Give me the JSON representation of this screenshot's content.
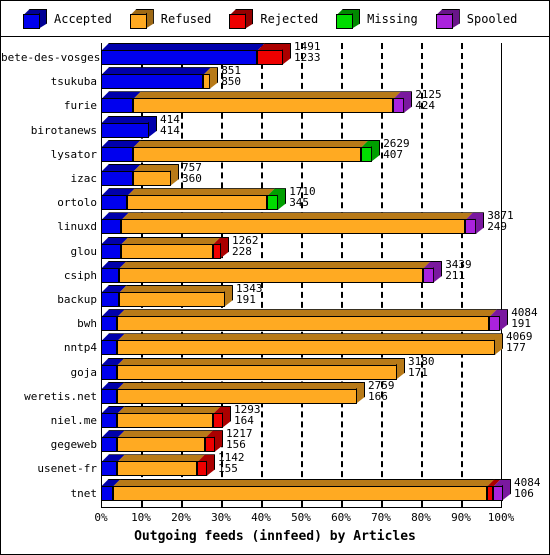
{
  "legend": {
    "items": [
      {
        "label": "Accepted",
        "color": "#0000ee",
        "icon": "cube-icon"
      },
      {
        "label": "Refused",
        "color": "#ffaa22",
        "icon": "cube-icon"
      },
      {
        "label": "Rejected",
        "color": "#ee0000",
        "icon": "cube-icon"
      },
      {
        "label": "Missing",
        "color": "#00dd00",
        "icon": "cube-icon"
      },
      {
        "label": "Spooled",
        "color": "#aa22dd",
        "icon": "cube-icon"
      }
    ]
  },
  "chart_data": {
    "type": "bar",
    "orientation": "horizontal",
    "stacked": true,
    "percent_stacked": true,
    "title": "Outgoing feeds (innfeed) by Articles",
    "xlabel": "Outgoing feeds (innfeed) by Articles",
    "ylabel": "",
    "xlim": [
      0,
      100
    ],
    "xticks": [
      "0%",
      "10%",
      "20%",
      "30%",
      "40%",
      "50%",
      "60%",
      "70%",
      "80%",
      "90%",
      "100%"
    ],
    "grid": true,
    "legend_position": "top",
    "series": [
      {
        "name": "Accepted",
        "color": "#0000ee"
      },
      {
        "name": "Refused",
        "color": "#ffaa22"
      },
      {
        "name": "Rejected",
        "color": "#ee0000"
      },
      {
        "name": "Missing",
        "color": "#00dd00"
      },
      {
        "name": "Spooled",
        "color": "#aa22dd"
      }
    ],
    "categories": [
      "bete-des-vosges",
      "tsukuba",
      "furie",
      "birotanews",
      "lysator",
      "izac",
      "ortolo",
      "linuxd",
      "glou",
      "csiph",
      "backup",
      "bwh",
      "nntp4",
      "goja",
      "weretis.net",
      "niel.me",
      "gegeweb",
      "usenet-fr",
      "tnet"
    ],
    "rows": [
      {
        "category": "bete-des-vosges",
        "total": 1491,
        "accepted": 1233,
        "label_top": "1491",
        "label_bottom": "1233",
        "segments": [
          {
            "name": "Accepted",
            "pct": 39.0
          },
          {
            "name": "Rejected",
            "pct": 6.5
          }
        ]
      },
      {
        "category": "tsukuba",
        "total": 851,
        "accepted": 850,
        "label_top": "851",
        "label_bottom": "850",
        "segments": [
          {
            "name": "Accepted",
            "pct": 25.5
          },
          {
            "name": "Refused",
            "pct": 1.8
          }
        ]
      },
      {
        "category": "furie",
        "total": 2125,
        "accepted": 424,
        "label_top": "2125",
        "label_bottom": "424",
        "segments": [
          {
            "name": "Accepted",
            "pct": 8.0
          },
          {
            "name": "Refused",
            "pct": 65.0
          },
          {
            "name": "Spooled",
            "pct": 2.8
          }
        ]
      },
      {
        "category": "birotanews",
        "total": 414,
        "accepted": 414,
        "label_top": "414",
        "label_bottom": "414",
        "segments": [
          {
            "name": "Accepted",
            "pct": 12.0
          }
        ]
      },
      {
        "category": "lysator",
        "total": 2629,
        "accepted": 407,
        "label_top": "2629",
        "label_bottom": "407",
        "segments": [
          {
            "name": "Accepted",
            "pct": 8.0
          },
          {
            "name": "Refused",
            "pct": 57.0
          },
          {
            "name": "Missing",
            "pct": 2.8
          }
        ]
      },
      {
        "category": "izac",
        "total": 757,
        "accepted": 360,
        "label_top": "757",
        "label_bottom": "360",
        "segments": [
          {
            "name": "Accepted",
            "pct": 8.0
          },
          {
            "name": "Refused",
            "pct": 9.5
          }
        ]
      },
      {
        "category": "ortolo",
        "total": 1710,
        "accepted": 345,
        "label_top": "1710",
        "label_bottom": "345",
        "segments": [
          {
            "name": "Accepted",
            "pct": 6.5
          },
          {
            "name": "Refused",
            "pct": 35.0
          },
          {
            "name": "Missing",
            "pct": 2.8
          }
        ]
      },
      {
        "category": "linuxd",
        "total": 3871,
        "accepted": 249,
        "label_top": "3871",
        "label_bottom": "249",
        "segments": [
          {
            "name": "Accepted",
            "pct": 5.0
          },
          {
            "name": "Refused",
            "pct": 86.0
          },
          {
            "name": "Spooled",
            "pct": 2.8
          }
        ]
      },
      {
        "category": "glou",
        "total": 1262,
        "accepted": 228,
        "label_top": "1262",
        "label_bottom": "228",
        "segments": [
          {
            "name": "Accepted",
            "pct": 5.0
          },
          {
            "name": "Refused",
            "pct": 23.0
          },
          {
            "name": "Rejected",
            "pct": 2.0
          }
        ]
      },
      {
        "category": "csiph",
        "total": 3439,
        "accepted": 211,
        "label_top": "3439",
        "label_bottom": "211",
        "segments": [
          {
            "name": "Accepted",
            "pct": 4.5
          },
          {
            "name": "Refused",
            "pct": 76.0
          },
          {
            "name": "Spooled",
            "pct": 2.8
          }
        ]
      },
      {
        "category": "backup",
        "total": 1343,
        "accepted": 191,
        "label_top": "1343",
        "label_bottom": "191",
        "segments": [
          {
            "name": "Accepted",
            "pct": 4.5
          },
          {
            "name": "Refused",
            "pct": 26.5
          }
        ]
      },
      {
        "category": "bwh",
        "total": 4084,
        "accepted": 191,
        "label_top": "4084",
        "label_bottom": "191",
        "segments": [
          {
            "name": "Accepted",
            "pct": 4.0
          },
          {
            "name": "Refused",
            "pct": 93.0
          },
          {
            "name": "Spooled",
            "pct": 2.8
          }
        ]
      },
      {
        "category": "nntp4",
        "total": 4069,
        "accepted": 177,
        "label_top": "4069",
        "label_bottom": "177",
        "segments": [
          {
            "name": "Accepted",
            "pct": 4.0
          },
          {
            "name": "Refused",
            "pct": 94.5
          }
        ]
      },
      {
        "category": "goja",
        "total": 3180,
        "accepted": 171,
        "label_top": "3180",
        "label_bottom": "171",
        "segments": [
          {
            "name": "Accepted",
            "pct": 4.0
          },
          {
            "name": "Refused",
            "pct": 70.0
          }
        ]
      },
      {
        "category": "weretis.net",
        "total": 2759,
        "accepted": 166,
        "label_top": "2759",
        "label_bottom": "166",
        "segments": [
          {
            "name": "Accepted",
            "pct": 4.0
          },
          {
            "name": "Refused",
            "pct": 60.0
          }
        ]
      },
      {
        "category": "niel.me",
        "total": 1293,
        "accepted": 164,
        "label_top": "1293",
        "label_bottom": "164",
        "segments": [
          {
            "name": "Accepted",
            "pct": 4.0
          },
          {
            "name": "Refused",
            "pct": 24.0
          },
          {
            "name": "Rejected",
            "pct": 2.5
          }
        ]
      },
      {
        "category": "gegeweb",
        "total": 1217,
        "accepted": 156,
        "label_top": "1217",
        "label_bottom": "156",
        "segments": [
          {
            "name": "Accepted",
            "pct": 4.0
          },
          {
            "name": "Refused",
            "pct": 22.0
          },
          {
            "name": "Rejected",
            "pct": 2.5
          }
        ]
      },
      {
        "category": "usenet-fr",
        "total": 1142,
        "accepted": 155,
        "label_top": "1142",
        "label_bottom": "155",
        "segments": [
          {
            "name": "Accepted",
            "pct": 4.0
          },
          {
            "name": "Refused",
            "pct": 20.0
          },
          {
            "name": "Rejected",
            "pct": 2.5
          }
        ]
      },
      {
        "category": "tnet",
        "total": 4084,
        "accepted": 106,
        "label_top": "4084",
        "label_bottom": "106",
        "segments": [
          {
            "name": "Accepted",
            "pct": 3.0
          },
          {
            "name": "Refused",
            "pct": 93.5
          },
          {
            "name": "Rejected",
            "pct": 1.6
          },
          {
            "name": "Spooled",
            "pct": 2.4
          }
        ]
      }
    ]
  }
}
